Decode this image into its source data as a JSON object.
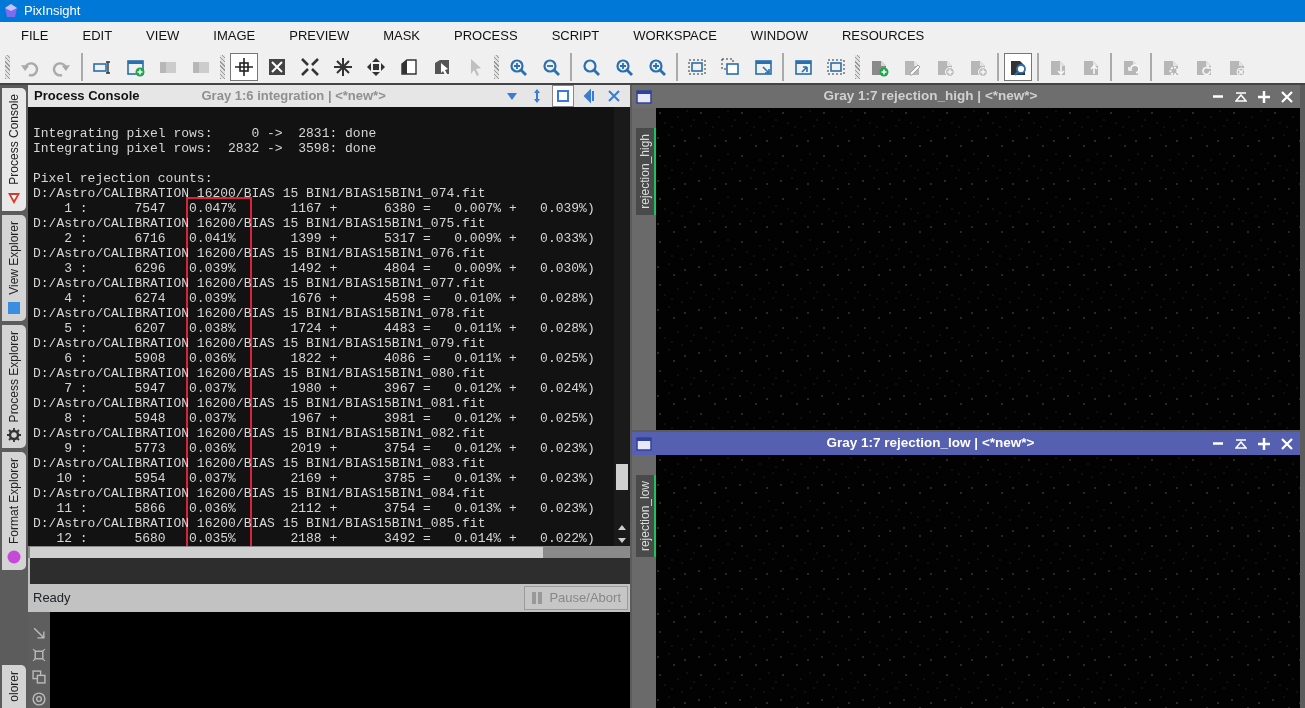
{
  "app": {
    "title": "PixInsight"
  },
  "menu": [
    "FILE",
    "EDIT",
    "VIEW",
    "IMAGE",
    "PREVIEW",
    "MASK",
    "PROCESS",
    "SCRIPT",
    "WORKSPACE",
    "WINDOW",
    "RESOURCES"
  ],
  "toolbar": [
    {
      "grip": true,
      "buttons": [
        {
          "selected": false,
          "disabled": true
        },
        {
          "selected": false,
          "disabled": true
        }
      ]
    },
    {
      "grip": false,
      "buttons": [
        {
          "selected": false,
          "disabled": false
        },
        {
          "selected": false,
          "disabled": false
        },
        {
          "selected": false,
          "disabled": true
        },
        {
          "selected": false,
          "disabled": true
        }
      ]
    },
    {
      "grip": true,
      "buttons": [
        {
          "selected": true,
          "disabled": false
        },
        {
          "selected": false,
          "disabled": false
        },
        {
          "selected": false,
          "disabled": false
        },
        {
          "selected": false,
          "disabled": false
        },
        {
          "selected": false,
          "disabled": false
        },
        {
          "selected": false,
          "disabled": false
        },
        {
          "selected": false,
          "disabled": false
        },
        {
          "selected": false,
          "disabled": true
        }
      ]
    },
    {
      "grip": true,
      "buttons": [
        {
          "selected": false,
          "disabled": false
        },
        {
          "selected": false,
          "disabled": false
        }
      ]
    },
    {
      "grip": false,
      "buttons": [
        {
          "selected": false,
          "disabled": false
        },
        {
          "selected": false,
          "disabled": false
        },
        {
          "selected": false,
          "disabled": false
        }
      ]
    },
    {
      "grip": false,
      "buttons": [
        {
          "selected": false,
          "disabled": false
        },
        {
          "selected": false,
          "disabled": false
        },
        {
          "selected": false,
          "disabled": false
        }
      ]
    },
    {
      "grip": false,
      "buttons": [
        {
          "selected": false,
          "disabled": false
        },
        {
          "selected": false,
          "disabled": false
        }
      ]
    },
    {
      "grip": true,
      "buttons": [
        {
          "selected": false,
          "disabled": false
        },
        {
          "selected": false,
          "disabled": true
        },
        {
          "selected": false,
          "disabled": true
        },
        {
          "selected": false,
          "disabled": true
        }
      ]
    },
    {
      "grip": false,
      "buttons": [
        {
          "selected": true,
          "disabled": false
        }
      ]
    },
    {
      "grip": false,
      "buttons": [
        {
          "selected": false,
          "disabled": true
        },
        {
          "selected": false,
          "disabled": true
        }
      ]
    },
    {
      "grip": false,
      "buttons": [
        {
          "selected": false,
          "disabled": true
        }
      ]
    },
    {
      "grip": false,
      "buttons": [
        {
          "selected": false,
          "disabled": true
        },
        {
          "selected": false,
          "disabled": true
        },
        {
          "selected": false,
          "disabled": true
        }
      ]
    }
  ],
  "sidebar": {
    "tabs": [
      {
        "label": "Process Console",
        "selected": true
      },
      {
        "label": "View Explorer",
        "selected": false
      },
      {
        "label": "Process Explorer",
        "selected": false
      },
      {
        "label": "Format Explorer",
        "selected": false
      }
    ],
    "bottom_tabs": [
      {
        "label": "olorer",
        "selected": false
      }
    ]
  },
  "console": {
    "title": "Process Console",
    "background_title": "Gray 1:6 integration | <*new*>",
    "lines": [
      {
        "kind": "blank"
      },
      {
        "kind": "text",
        "text": "Integrating pixel rows:     0 ->  2831: done"
      },
      {
        "kind": "text",
        "text": "Integrating pixel rows:  2832 ->  3598: done"
      },
      {
        "kind": "blank"
      },
      {
        "kind": "text",
        "text": "Pixel rejection counts:"
      },
      {
        "kind": "file",
        "text": "D:/Astro/CALIBRATION 16200/BIAS 15 BIN1/BIAS15BIN1_074.fit"
      },
      {
        "kind": "counts",
        "text": "    1 :      7547   0.047%       1167 +      6380 =   0.007% +   0.039%)"
      },
      {
        "kind": "file",
        "text": "D:/Astro/CALIBRATION 16200/BIAS 15 BIN1/BIAS15BIN1_075.fit"
      },
      {
        "kind": "counts",
        "text": "    2 :      6716   0.041%       1399 +      5317 =   0.009% +   0.033%)"
      },
      {
        "kind": "file",
        "text": "D:/Astro/CALIBRATION 16200/BIAS 15 BIN1/BIAS15BIN1_076.fit"
      },
      {
        "kind": "counts",
        "text": "    3 :      6296   0.039%       1492 +      4804 =   0.009% +   0.030%)"
      },
      {
        "kind": "file",
        "text": "D:/Astro/CALIBRATION 16200/BIAS 15 BIN1/BIAS15BIN1_077.fit"
      },
      {
        "kind": "counts",
        "text": "    4 :      6274   0.039%       1676 +      4598 =   0.010% +   0.028%)"
      },
      {
        "kind": "file",
        "text": "D:/Astro/CALIBRATION 16200/BIAS 15 BIN1/BIAS15BIN1_078.fit"
      },
      {
        "kind": "counts",
        "text": "    5 :      6207   0.038%       1724 +      4483 =   0.011% +   0.028%)"
      },
      {
        "kind": "file",
        "text": "D:/Astro/CALIBRATION 16200/BIAS 15 BIN1/BIAS15BIN1_079.fit"
      },
      {
        "kind": "counts",
        "text": "    6 :      5908   0.036%       1822 +      4086 =   0.011% +   0.025%)"
      },
      {
        "kind": "file",
        "text": "D:/Astro/CALIBRATION 16200/BIAS 15 BIN1/BIAS15BIN1_080.fit"
      },
      {
        "kind": "counts",
        "text": "    7 :      5947   0.037%       1980 +      3967 =   0.012% +   0.024%)"
      },
      {
        "kind": "file",
        "text": "D:/Astro/CALIBRATION 16200/BIAS 15 BIN1/BIAS15BIN1_081.fit"
      },
      {
        "kind": "counts",
        "text": "    8 :      5948   0.037%       1967 +      3981 =   0.012% +   0.025%)"
      },
      {
        "kind": "file",
        "text": "D:/Astro/CALIBRATION 16200/BIAS 15 BIN1/BIAS15BIN1_082.fit"
      },
      {
        "kind": "counts",
        "text": "    9 :      5773   0.036%       2019 +      3754 =   0.012% +   0.023%)"
      },
      {
        "kind": "file",
        "text": "D:/Astro/CALIBRATION 16200/BIAS 15 BIN1/BIAS15BIN1_083.fit"
      },
      {
        "kind": "counts",
        "text": "   10 :      5954   0.037%       2169 +      3785 =   0.013% +   0.023%)"
      },
      {
        "kind": "file",
        "text": "D:/Astro/CALIBRATION 16200/BIAS 15 BIN1/BIAS15BIN1_084.fit"
      },
      {
        "kind": "counts",
        "text": "   11 :      5866   0.036%       2112 +      3754 =   0.013% +   0.023%)"
      },
      {
        "kind": "file",
        "text": "D:/Astro/CALIBRATION 16200/BIAS 15 BIN1/BIAS15BIN1_085.fit"
      },
      {
        "kind": "counts",
        "text": "   12 :      5680   0.035%       2188 +      3492 =   0.014% +   0.022%)"
      }
    ],
    "status": "Ready",
    "pause_button": {
      "label": "Pause/Abort",
      "disabled": true
    }
  },
  "image_windows": [
    {
      "title": "Gray 1:7 rejection_high | <*new*>",
      "tab": "rejection_high",
      "active": false
    },
    {
      "title": "Gray 1:7 rejection_low | <*new*>",
      "tab": "rejection_low",
      "active": true
    }
  ]
}
